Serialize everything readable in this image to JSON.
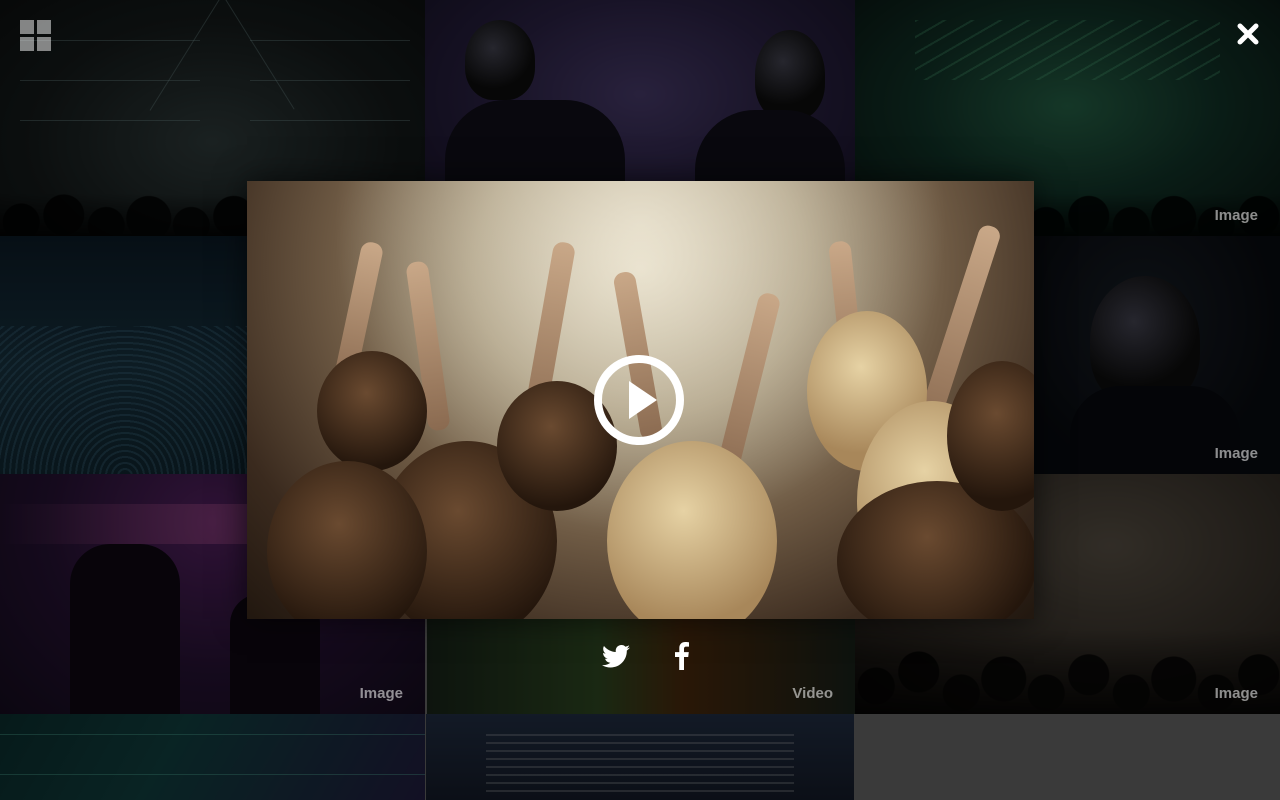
{
  "gallery": {
    "tiles": [
      {
        "id": "t1",
        "label": ""
      },
      {
        "id": "t2",
        "label": ""
      },
      {
        "id": "t3",
        "label": "Image"
      },
      {
        "id": "t4",
        "label": ""
      },
      {
        "id": "t5",
        "label": "Image"
      },
      {
        "id": "t6",
        "label": "Image"
      },
      {
        "id": "t7",
        "label": "Video"
      },
      {
        "id": "t8",
        "label": "Image"
      },
      {
        "id": "t9",
        "label": ""
      },
      {
        "id": "t10",
        "label": ""
      }
    ]
  },
  "toolbar": {
    "menu_icon": "grid-icon",
    "close_icon": "close-icon"
  },
  "lightbox": {
    "media_type": "video",
    "play_icon": "play-icon"
  },
  "share": {
    "icons": [
      "twitter-icon",
      "facebook-icon"
    ]
  },
  "colors": {
    "overlay": "#000000",
    "icon": "#ffffff"
  }
}
